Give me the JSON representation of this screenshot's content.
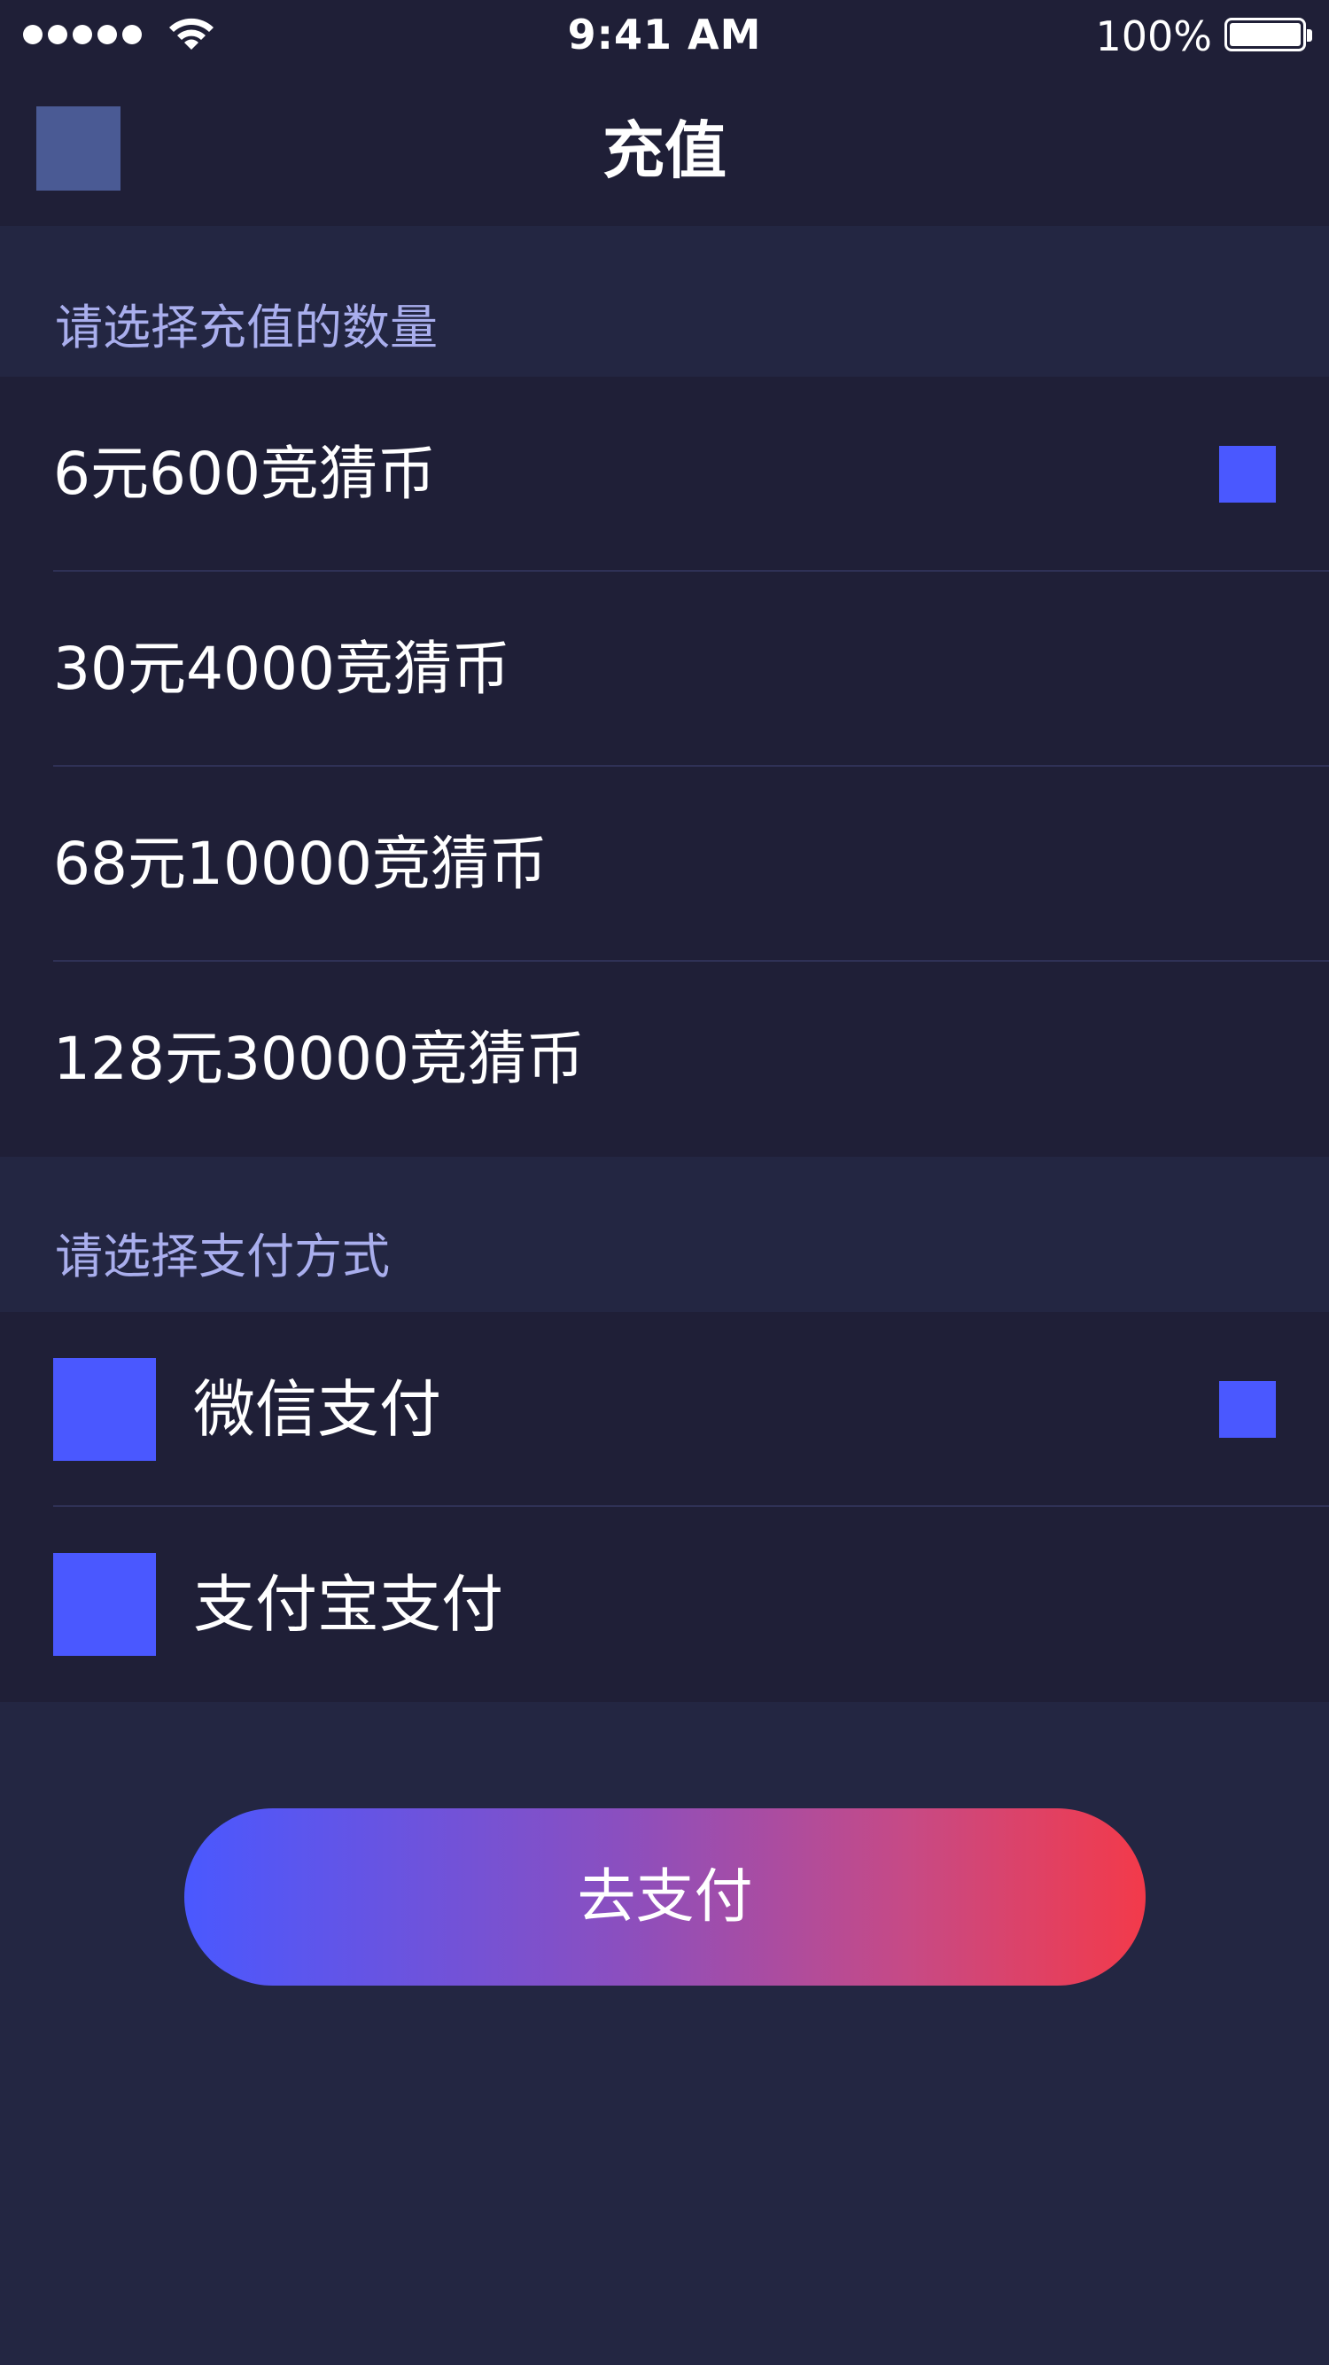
{
  "status_bar": {
    "time": "9:41 AM",
    "battery_percent": "100%",
    "signal_icon": "signal-dots-icon",
    "wifi_icon": "wifi-icon",
    "battery_icon": "battery-icon",
    "battery_level": 1.0
  },
  "nav": {
    "title": "充值",
    "back_icon": "back-icon"
  },
  "amount_section": {
    "header": "请选择充值的数量",
    "options": [
      {
        "label": "6元600竞猜币",
        "selected": true
      },
      {
        "label": "30元4000竞猜币",
        "selected": false
      },
      {
        "label": "68元10000竞猜币",
        "selected": false
      },
      {
        "label": "128元30000竞猜币",
        "selected": false
      }
    ]
  },
  "payment_section": {
    "header": "请选择支付方式",
    "methods": [
      {
        "label": "微信支付",
        "icon": "wechat-pay-icon",
        "selected": true
      },
      {
        "label": "支付宝支付",
        "icon": "alipay-icon",
        "selected": false
      }
    ]
  },
  "pay_button": {
    "label": "去支付"
  },
  "colors": {
    "background": "#232642",
    "list_background": "#1f1f37",
    "section_label": "#a9aeed",
    "accent": "#4a58ff",
    "button_gradient_start": "#4a58ff",
    "button_gradient_end": "#f33a4a"
  }
}
